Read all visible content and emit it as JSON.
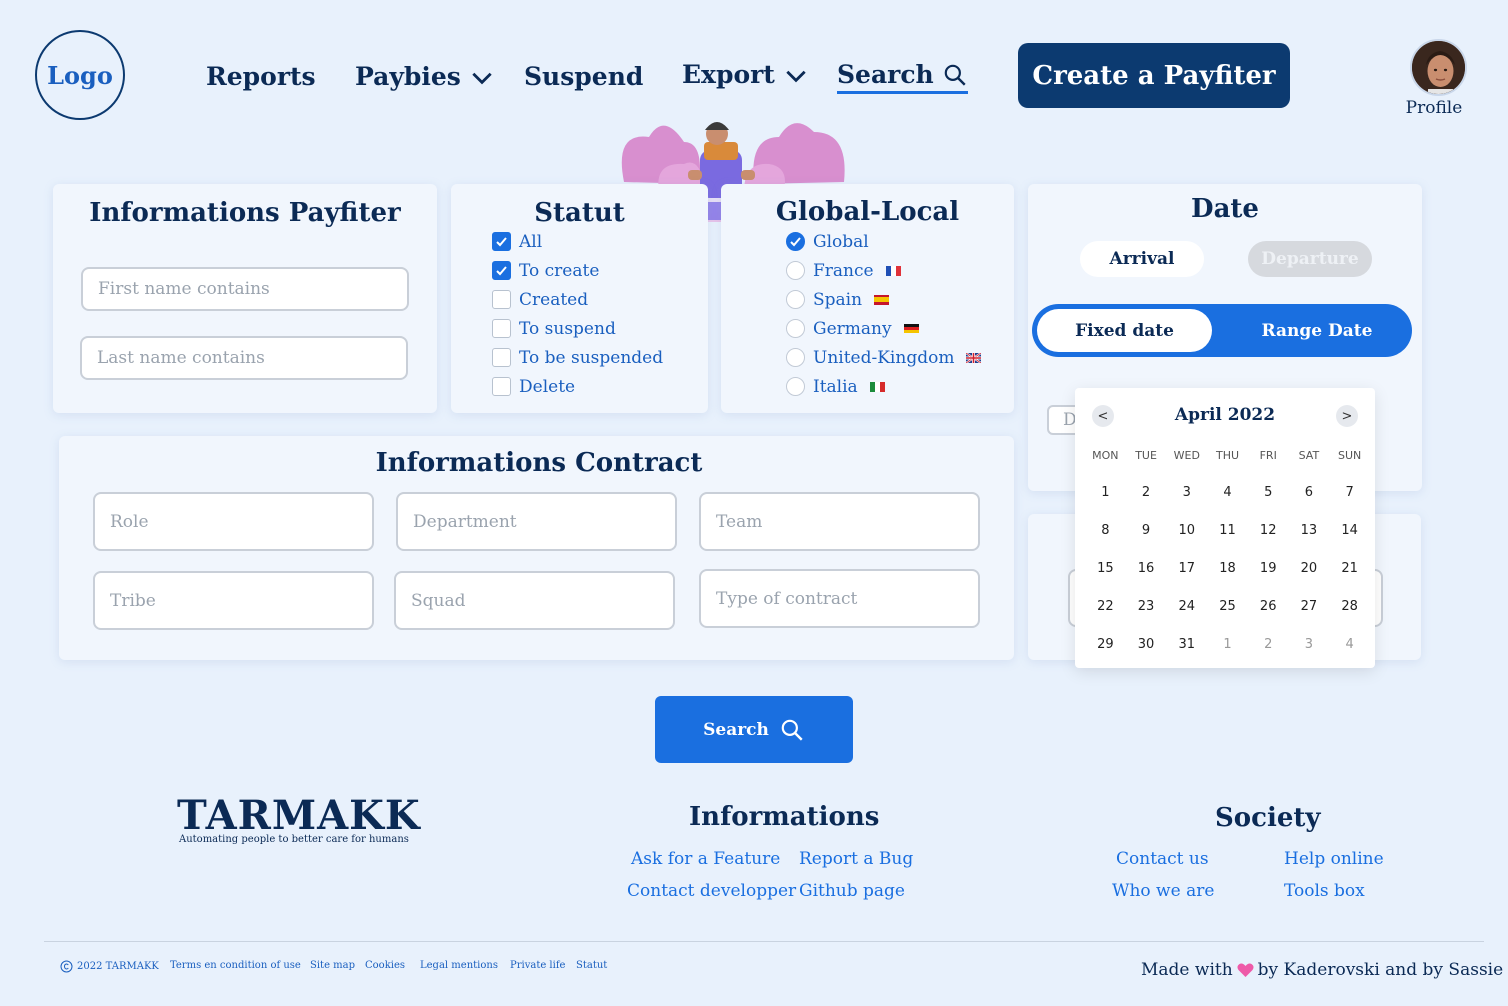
{
  "header": {
    "logo": "Logo",
    "nav": {
      "reports": "Reports",
      "paybies": "Paybies",
      "suspend": "Suspend",
      "export": "Export",
      "search": "Search"
    },
    "create_button": "Create a Payfiter",
    "profile_label": "Profile"
  },
  "info_payfiter": {
    "title": "Informations Payfiter",
    "first_name_placeholder": "First name contains",
    "last_name_placeholder": "Last name contains"
  },
  "statut": {
    "title": "Statut",
    "options": [
      {
        "label": "All",
        "checked": true
      },
      {
        "label": "To create",
        "checked": true
      },
      {
        "label": "Created",
        "checked": false
      },
      {
        "label": "To suspend",
        "checked": false
      },
      {
        "label": "To be suspended",
        "checked": false
      },
      {
        "label": "Delete",
        "checked": false
      }
    ]
  },
  "global_local": {
    "title": "Global-Local",
    "options": [
      {
        "label": "Global",
        "selected": true
      },
      {
        "label": "France",
        "selected": false
      },
      {
        "label": "Spain",
        "selected": false
      },
      {
        "label": "Germany",
        "selected": false
      },
      {
        "label": "United-Kingdom",
        "selected": false
      },
      {
        "label": "Italia",
        "selected": false
      }
    ]
  },
  "date": {
    "title": "Date",
    "arrival": "Arrival",
    "departure": "Departure",
    "fixed_date": "Fixed date",
    "range_date": "Range Date",
    "date_input_partial": "D"
  },
  "calendar": {
    "prev": "<",
    "next": ">",
    "month": "April 2022",
    "weekdays": [
      "MON",
      "TUE",
      "WED",
      "THU",
      "FRI",
      "SAT",
      "SUN"
    ],
    "days": [
      "1",
      "2",
      "3",
      "4",
      "5",
      "6",
      "7",
      "8",
      "9",
      "10",
      "11",
      "12",
      "13",
      "14",
      "15",
      "16",
      "17",
      "18",
      "19",
      "20",
      "21",
      "22",
      "23",
      "24",
      "25",
      "26",
      "27",
      "28",
      "29",
      "30",
      "31",
      "1",
      "2",
      "3",
      "4"
    ]
  },
  "contract": {
    "title": "Informations Contract",
    "role": "Role",
    "department": "Department",
    "team": "Team",
    "tribe": "Tribe",
    "squad": "Squad",
    "type_of_contract": "Type of contract"
  },
  "search_button": "Search",
  "footer": {
    "brand": "TARMAKK",
    "tagline": "Automating people to better care for humans",
    "informations_title": "Informations",
    "ask_feature": "Ask for a Feature",
    "report_bug": "Report a Bug",
    "contact_dev": "Contact developper",
    "github": "Github page",
    "society_title": "Society",
    "contact_us": "Contact us",
    "help_online": "Help online",
    "who_we_are": "Who we are",
    "tools_box": "Tools box",
    "copyright": "2022 TARMAKK",
    "terms": "Terms en condition of use",
    "site_map": "Site map",
    "cookies": "Cookies",
    "legal": "Legal mentions",
    "private": "Private life",
    "statut": "Statut",
    "made_with": "Made with",
    "made_by": "by Kaderovski and by Sassie"
  },
  "colors": {
    "primary_dark": "#0c3a70",
    "primary": "#1a6fe0",
    "background": "#e8f1fc"
  }
}
